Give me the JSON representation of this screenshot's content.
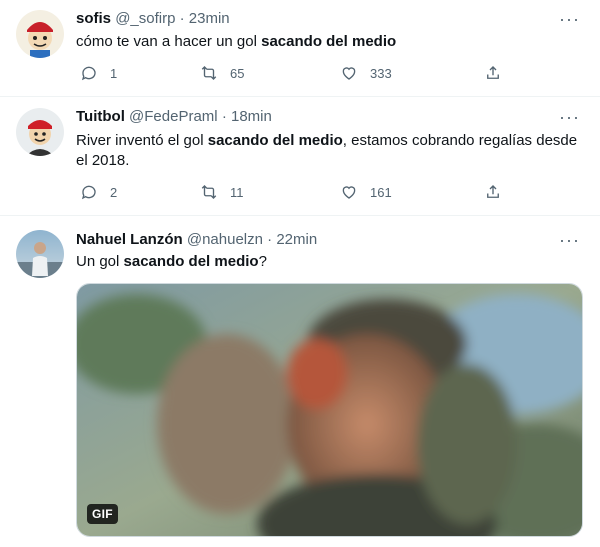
{
  "tweets": [
    {
      "name": "sofis",
      "handle": "@_sofirp",
      "separator": "·",
      "time": "23min",
      "more": "···",
      "text_pre": "cómo te van a hacer un gol ",
      "text_bold": "sacando del medio",
      "text_post": "",
      "replies": "1",
      "retweets": "65",
      "likes": "333"
    },
    {
      "name": "Tuitbol",
      "handle": "@FedePraml",
      "separator": "·",
      "time": "18min",
      "more": "···",
      "text_pre": "River inventó el gol ",
      "text_bold": "sacando del medio",
      "text_post": ", estamos cobrando regalías desde el 2018.",
      "replies": "2",
      "retweets": "11",
      "likes": "161"
    },
    {
      "name": "Nahuel Lanzón",
      "handle": "@nahuelzn",
      "separator": "·",
      "time": "22min",
      "more": "···",
      "text_pre": "Un gol ",
      "text_bold": "sacando del medio",
      "text_post": "?",
      "media_badge": "GIF"
    }
  ],
  "colors": {
    "text": "#0f1419",
    "secondary": "#536471",
    "border": "#eff3f4"
  },
  "icons": [
    "reply-icon",
    "retweet-icon",
    "like-icon",
    "share-icon",
    "more-icon"
  ]
}
